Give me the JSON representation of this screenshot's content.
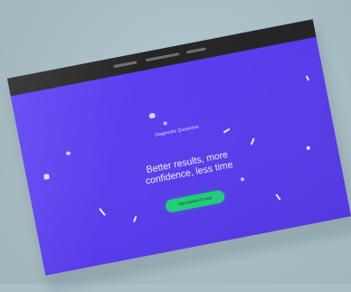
{
  "page": {
    "kicker": "Diagnostic Questions",
    "headline": "Better results, more confidence, less time",
    "cta_label": "Get started it's free"
  },
  "colors": {
    "background": "#aac0c7",
    "topbar": "#262626",
    "hero": "#5b3ff0",
    "accent": "#23d17a"
  },
  "icons": {
    "decor": [
      "sparkle-icon",
      "dot-icon",
      "dash-icon"
    ]
  }
}
